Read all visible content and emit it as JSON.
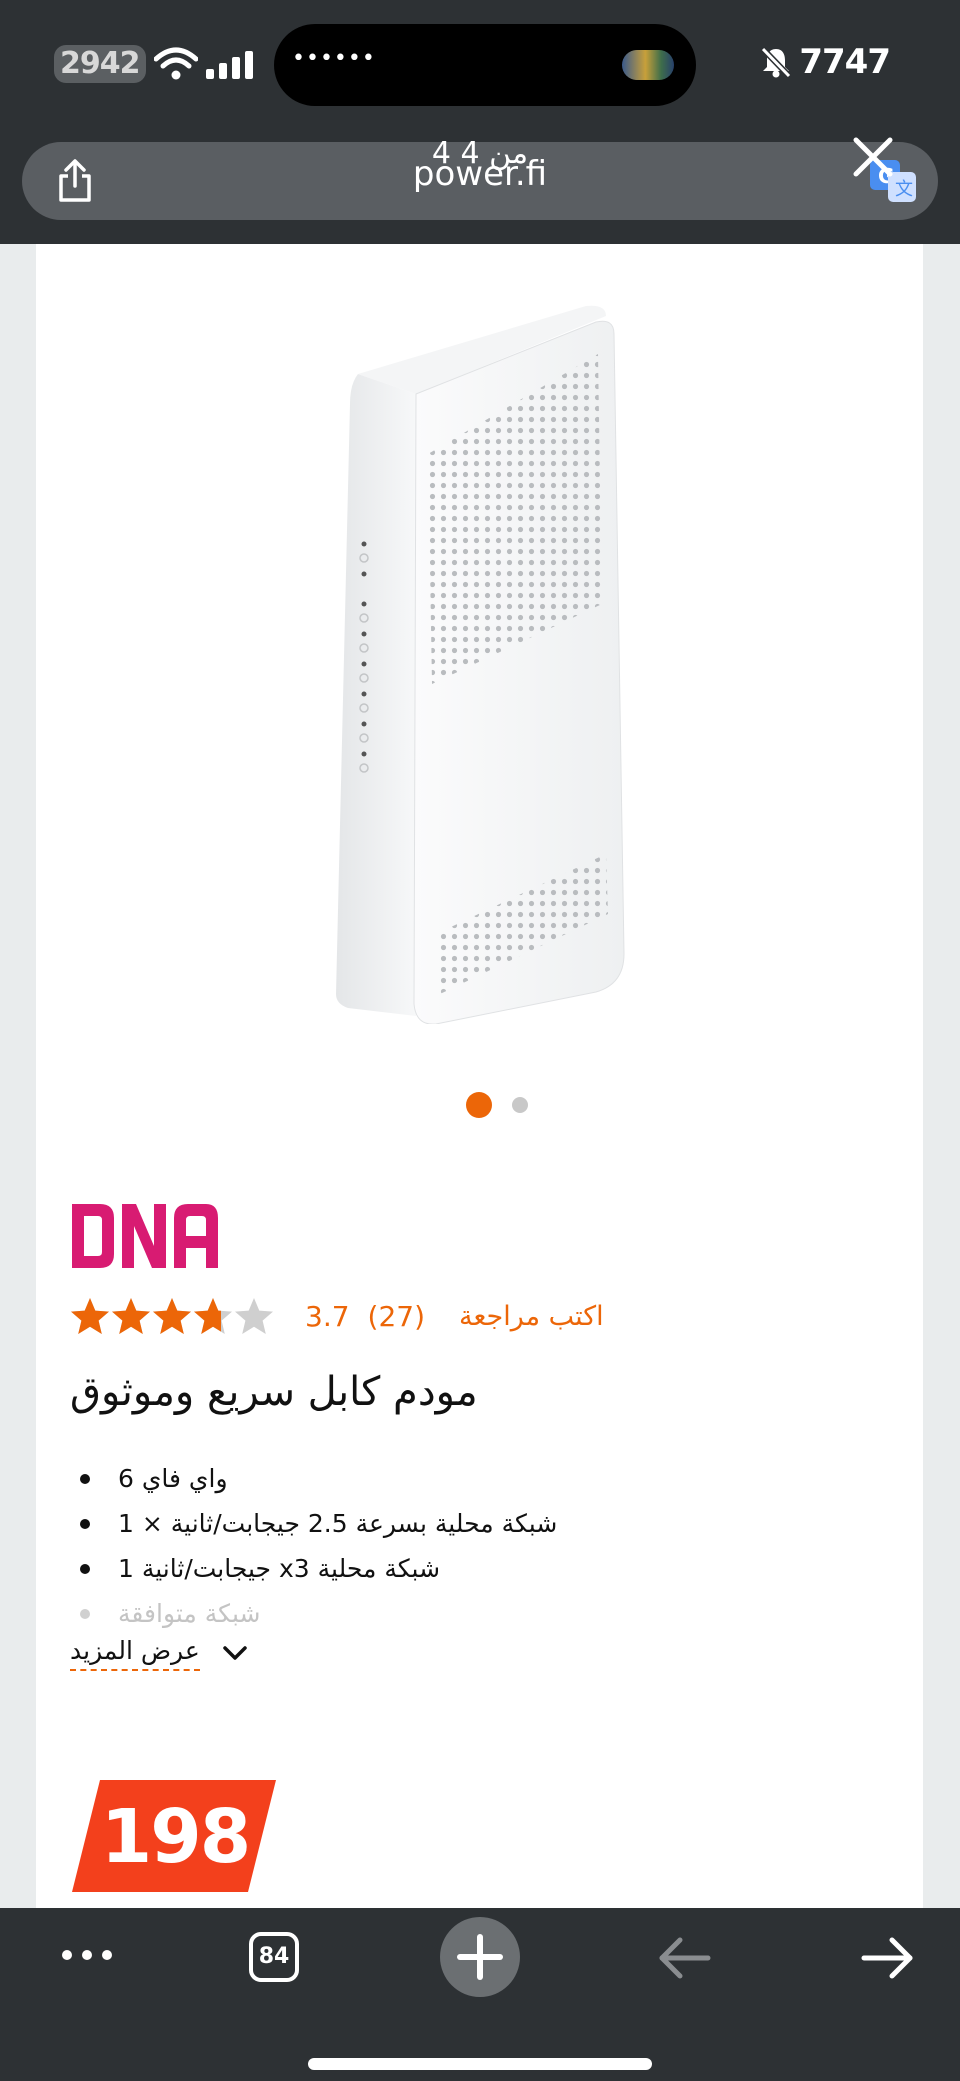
{
  "status_bar": {
    "time": "2942",
    "right_text": "7747"
  },
  "browser": {
    "host": "power.fi",
    "page_counter": "4 من 4",
    "tabs_count": "84"
  },
  "product": {
    "brand": "DNA",
    "rating": {
      "score": "3.7",
      "count": "(27)",
      "stars": 3.7,
      "max_stars": 5,
      "review_link": "اكتب مراجعة"
    },
    "title": "مودم كابل سريع وموثوق",
    "features": [
      "واي فاي 6",
      "شبكة محلية بسرعة 2.5 جيجابت/ثانية × 1",
      "جيجابت/ثانية 1 xشبكة محلية 3",
      "شبكة متوافقة"
    ],
    "show_more": "عرض المزيد",
    "price": "198"
  },
  "carousel": {
    "total": 2,
    "active": 1
  },
  "colors": {
    "accent": "#ec6608",
    "price_badge": "#f3401c",
    "brand_logo": "#d81b72",
    "chrome": "#2d3134"
  }
}
